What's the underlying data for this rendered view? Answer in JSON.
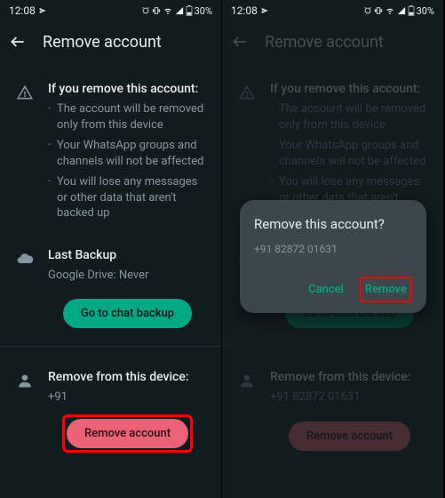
{
  "status": {
    "time": "12:08",
    "battery": "30%"
  },
  "app_bar": {
    "title": "Remove account"
  },
  "warning": {
    "title": "If you remove this account:",
    "bullets": [
      "The account will be removed only from this device",
      "Your WhatsApp groups and channels will not be affected",
      "You will lose any messages or other data that aren't backed up"
    ]
  },
  "backup": {
    "title": "Last Backup",
    "subtitle": "Google Drive: Never",
    "button": "Go to chat backup"
  },
  "remove": {
    "title": "Remove from this device:",
    "phone_left": "+91",
    "phone_right": "+91 82872 01631",
    "button": "Remove account"
  },
  "dialog": {
    "title": "Remove this account?",
    "phone": "+91 82872 01631",
    "cancel": "Cancel",
    "confirm": "Remove"
  }
}
